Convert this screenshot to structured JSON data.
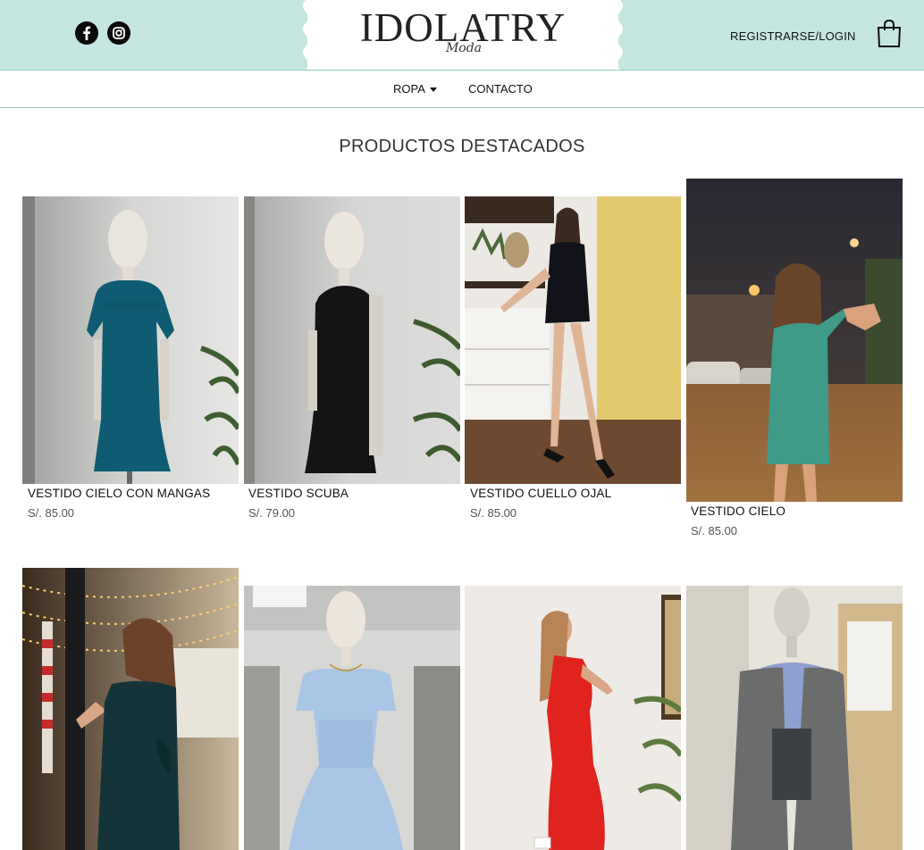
{
  "header": {
    "brand": "IDOLATRY",
    "brand_sub": "Moda",
    "login_label": "REGISTRARSE/LOGIN",
    "icons": [
      "facebook-icon",
      "instagram-icon",
      "shopping-bag-icon"
    ],
    "colors": {
      "header_bg": "#c5e6e0",
      "divider": "#8fc9bd"
    }
  },
  "nav": {
    "items": [
      {
        "label": "ROPA"
      },
      {
        "label": "CONTACTO"
      }
    ]
  },
  "section": {
    "title": "PRODUCTOS DESTACADOS"
  },
  "products": [
    {
      "name": "VESTIDO CIELO CON MANGAS",
      "price": "S/. 85.00"
    },
    {
      "name": "VESTIDO SCUBA",
      "price": "S/. 79.00"
    },
    {
      "name": "VESTIDO CUELLO OJAL",
      "price": "S/. 85.00"
    },
    {
      "name": "VESTIDO CIELO",
      "price": "S/. 85.00"
    },
    {
      "name": "",
      "price": ""
    },
    {
      "name": "",
      "price": ""
    },
    {
      "name": "",
      "price": ""
    },
    {
      "name": "",
      "price": ""
    }
  ]
}
